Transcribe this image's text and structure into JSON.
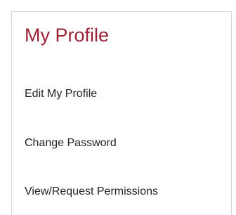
{
  "profile_menu": {
    "title": "My Profile",
    "title_color": "#9b2335",
    "items": [
      {
        "label": "Edit My Profile"
      },
      {
        "label": "Change Password"
      },
      {
        "label": "View/Request Permissions"
      }
    ]
  }
}
